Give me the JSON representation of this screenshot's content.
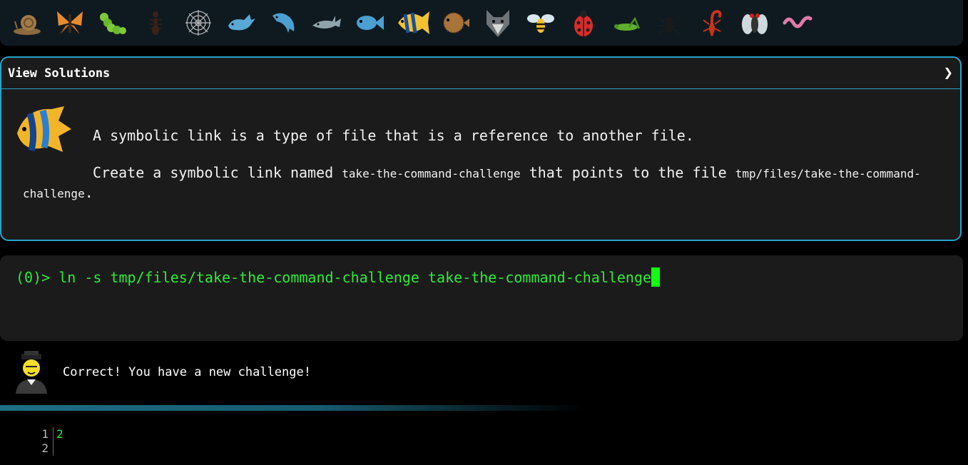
{
  "icon_bar": {
    "icons": [
      "snail-icon",
      "butterfly-icon",
      "caterpillar-icon",
      "ant-icon",
      "spider-web-icon",
      "whale-icon",
      "dolphin-icon",
      "shark-icon",
      "fish-icon",
      "tropical-fish-icon",
      "blowfish-icon",
      "wolf-icon",
      "bee-icon",
      "ladybug-icon",
      "cricket-icon",
      "spider-icon",
      "scorpion-icon",
      "fly-icon",
      "worm-icon"
    ],
    "active_icon": "tropical-fish-icon"
  },
  "solutions": {
    "header": "View Solutions",
    "chevron": "❯",
    "line1": "A symbolic link is a type of file that is a reference to another file.",
    "line2_prefix": "Create a symbolic link named ",
    "line2_code1": "take-the-command-challenge",
    "line2_mid": " that points to the file ",
    "line2_code2": "tmp/files/take-the-command-challenge",
    "line2_suffix": "."
  },
  "terminal": {
    "prompt": "(0)>",
    "command": "ln -s tmp/files/take-the-command-challenge take-the-command-challenge"
  },
  "feedback": {
    "message": "Correct! You have a new challenge!"
  },
  "output": {
    "line_numbers": [
      "1",
      "2"
    ],
    "lines": [
      "2",
      ""
    ]
  },
  "colors": {
    "accent": "#27a3c9",
    "terminal_text": "#2eea3b",
    "panel_bg": "#1b1b1b"
  }
}
